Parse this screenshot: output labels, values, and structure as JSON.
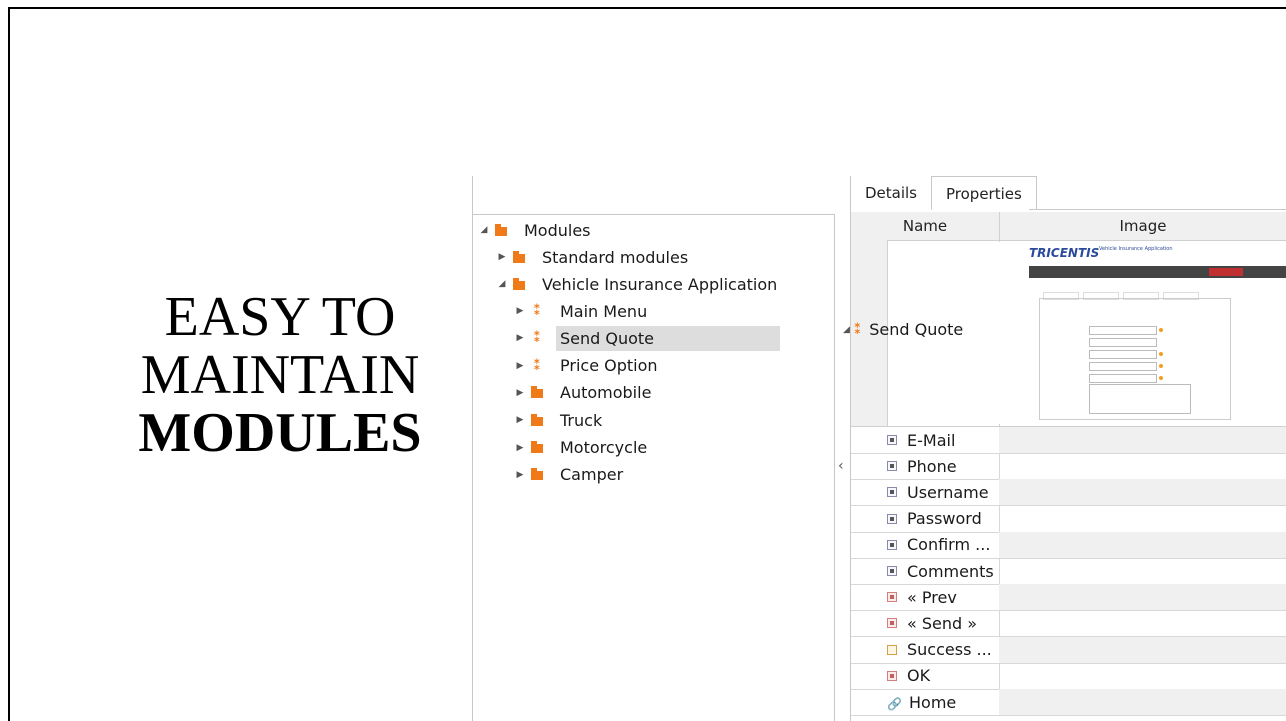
{
  "slide": {
    "heading_line1": "EASY TO",
    "heading_line2": "MAINTAIN",
    "heading_line3": "MODULES"
  },
  "tree": {
    "root": "Modules",
    "standard": "Standard modules",
    "vehicle_app": "Vehicle Insurance Application",
    "items": [
      {
        "label": "Main Menu",
        "type": "module"
      },
      {
        "label": "Send Quote",
        "type": "module",
        "selected": true
      },
      {
        "label": "Price Option",
        "type": "module"
      },
      {
        "label": "Automobile",
        "type": "folder"
      },
      {
        "label": "Truck",
        "type": "folder"
      },
      {
        "label": "Motorcycle",
        "type": "folder"
      },
      {
        "label": "Camper",
        "type": "folder"
      }
    ]
  },
  "details": {
    "tabs": [
      "Details",
      "Properties"
    ],
    "col_name": "Name",
    "col_image": "Image",
    "module_name": "Send Quote",
    "thumbnail_brand": "TRICENTIS",
    "thumbnail_app_title": "Vehicle Insurance Application",
    "fields": [
      {
        "label": "E-Mail",
        "icon": "input"
      },
      {
        "label": "Phone",
        "icon": "input"
      },
      {
        "label": "Username",
        "icon": "input"
      },
      {
        "label": "Password",
        "icon": "input"
      },
      {
        "label": "Confirm ...",
        "icon": "input"
      },
      {
        "label": "Comments",
        "icon": "input"
      },
      {
        "label": "« Prev",
        "icon": "button"
      },
      {
        "label": "« Send »",
        "icon": "button"
      },
      {
        "label": "Success ...",
        "icon": "text"
      },
      {
        "label": "OK",
        "icon": "button"
      },
      {
        "label": "Home",
        "icon": "link"
      }
    ]
  }
}
